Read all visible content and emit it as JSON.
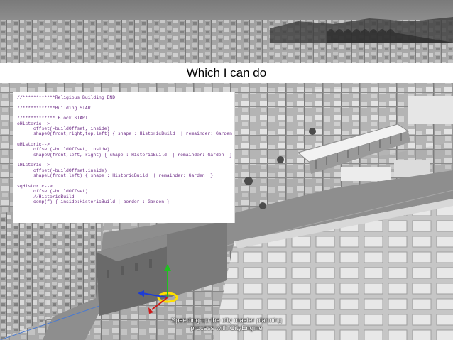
{
  "slide": {
    "title": "Which I can do",
    "caption": "Speeding up the city master planning process with CityEngine"
  },
  "code_lines": [
    "//************Religious Building END",
    "",
    "//************Building START",
    "",
    "//************ Block START",
    "oHistoric-->",
    "      offset(-buildOffset, inside)",
    "      shapeO(front,right,top,left) { shape : HistoricBuild  | remainder: Garden  }",
    "",
    "uHistoric-->",
    "      offset(-buildOffset, inside)",
    "      shapeU(front,left, right) { shape : HistoricBuild  | remainder: Garden  }",
    "",
    "lHistoric-->",
    "      offset(-buildOffset,inside)",
    "      shapeL(front,left) { shape : HistoricBuild  | remainder: Garden  }",
    "",
    "sqHistoric-->",
    "      offset(-buildOffset)",
    "      //HistoricBuild",
    "      comp(f) { inside:HistoricBuild | border : Garden }"
  ],
  "colors": {
    "code_text": "#6d2c86",
    "title_bar": "#ffffff",
    "gizmo_x": "#d01818",
    "gizmo_y": "#20c020",
    "gizmo_z": "#1c3cd8",
    "gizmo_ring": "#ffe000"
  }
}
